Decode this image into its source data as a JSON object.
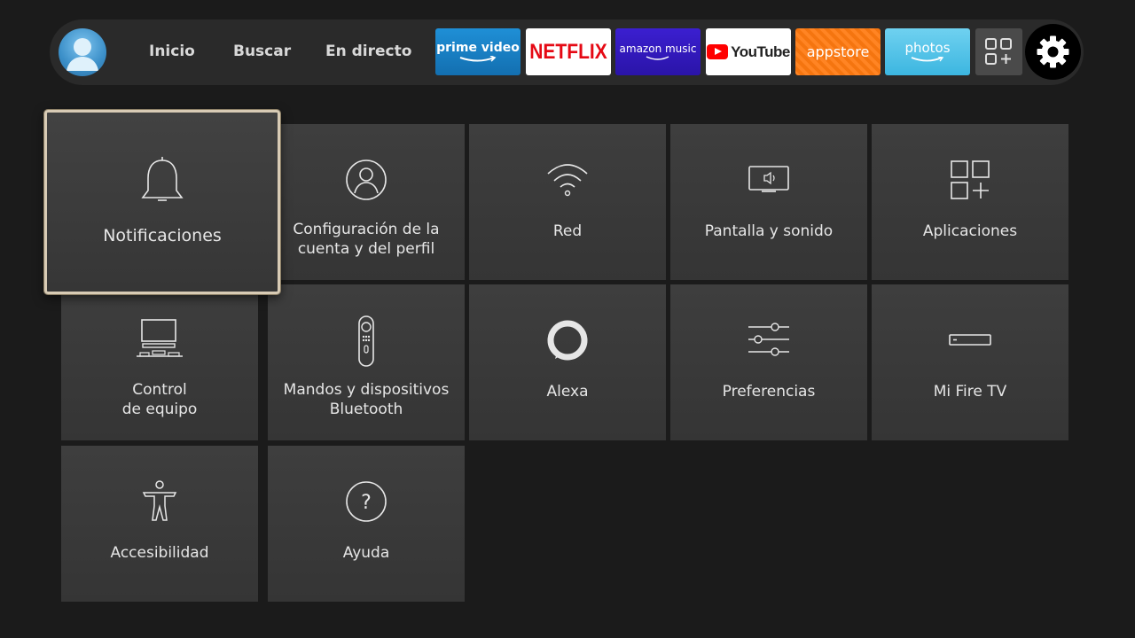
{
  "nav": {
    "inicio": "Inicio",
    "buscar": "Buscar",
    "en_directo": "En directo"
  },
  "apps": {
    "prime": "prime video",
    "netflix": "NETFLIX",
    "music": "amazon music",
    "youtube": "YouTube",
    "appstore": "appstore",
    "photos": "photos"
  },
  "tiles": {
    "notificaciones": "Notificaciones",
    "cuenta_l1": "Configuración de la",
    "cuenta_l2": "cuenta y del perfil",
    "red": "Red",
    "pantalla": "Pantalla y sonido",
    "aplicaciones": "Aplicaciones",
    "control_l1": "Control",
    "control_l2": "de equipo",
    "mandos_l1": "Mandos y dispositivos",
    "mandos_l2": "Bluetooth",
    "alexa": "Alexa",
    "preferencias": "Preferencias",
    "mifire": "Mi Fire TV",
    "accesibilidad": "Accesibilidad",
    "ayuda": "Ayuda"
  },
  "colors": {
    "background": "#1b1b1b",
    "topbar": "#2a2a2a",
    "tile": "#3b3b3b",
    "focus_border": "#d8cbb5",
    "netflix_red": "#e50914",
    "prime_blue": "#1f8fd6",
    "music_purple": "#3b1fd0",
    "appstore_orange": "#ff7a10",
    "photos_cyan": "#5ac6ea"
  },
  "icons": [
    "profile-icon",
    "grid-plus-icon",
    "gear-icon",
    "bell-icon",
    "person-circle-icon",
    "wifi-icon",
    "tv-sound-icon",
    "apps-grid-icon",
    "equipment-icon",
    "remote-icon",
    "alexa-ring-icon",
    "sliders-icon",
    "fire-tv-stick-icon",
    "accessibility-icon",
    "help-icon"
  ]
}
